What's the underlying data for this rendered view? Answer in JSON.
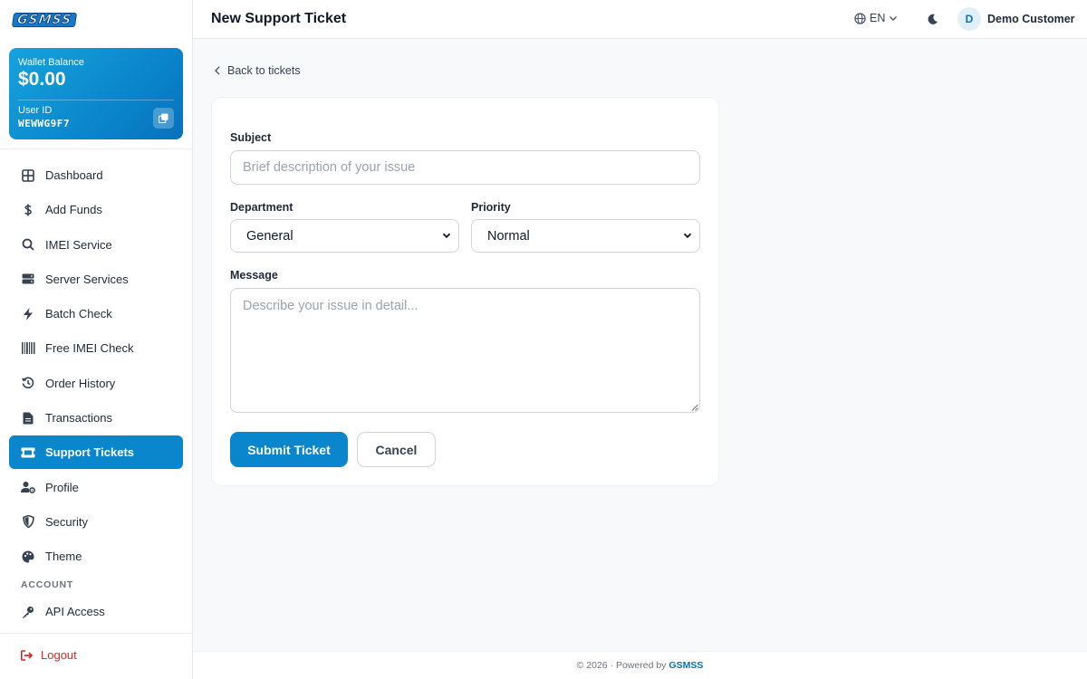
{
  "brand": {
    "logo_text": "GSMSS"
  },
  "wallet": {
    "balance_label": "Wallet Balance",
    "balance_value": "$0.00",
    "user_id_label": "User ID",
    "user_id_value": "WEWWG9F7"
  },
  "sidebar": {
    "items": [
      {
        "label": "Dashboard",
        "icon": "grid-icon"
      },
      {
        "label": "Add Funds",
        "icon": "dollar-icon"
      },
      {
        "label": "IMEI Service",
        "icon": "search-icon"
      },
      {
        "label": "Server Services",
        "icon": "server-icon"
      },
      {
        "label": "Batch Check",
        "icon": "bolt-icon"
      },
      {
        "label": "Free IMEI Check",
        "icon": "barcode-icon"
      },
      {
        "label": "Order History",
        "icon": "history-icon"
      },
      {
        "label": "Transactions",
        "icon": "file-icon"
      },
      {
        "label": "Support Tickets",
        "icon": "ticket-icon",
        "active": true
      },
      {
        "label": "Profile",
        "icon": "user-gear-icon"
      },
      {
        "label": "Security",
        "icon": "shield-icon"
      },
      {
        "label": "Theme",
        "icon": "palette-icon"
      }
    ],
    "account_section_label": "ACCOUNT",
    "account_items": [
      {
        "label": "API Access",
        "icon": "key-icon"
      }
    ],
    "logout_label": "Logout"
  },
  "header": {
    "title": "New Support Ticket",
    "language": "EN",
    "user_initial": "D",
    "user_name": "Demo Customer"
  },
  "main": {
    "back_label": "Back to tickets",
    "form": {
      "subject_label": "Subject",
      "subject_placeholder": "Brief description of your issue",
      "subject_value": "",
      "department_label": "Department",
      "department_value": "General",
      "priority_label": "Priority",
      "priority_value": "Normal",
      "message_label": "Message",
      "message_placeholder": "Describe your issue in detail...",
      "message_value": "",
      "submit_label": "Submit Ticket",
      "cancel_label": "Cancel"
    }
  },
  "footer": {
    "copyright": "© 2026 · Powered by",
    "brand": "GSMSS"
  },
  "colors": {
    "accent": "#0a86cc",
    "danger": "#dc2626"
  }
}
